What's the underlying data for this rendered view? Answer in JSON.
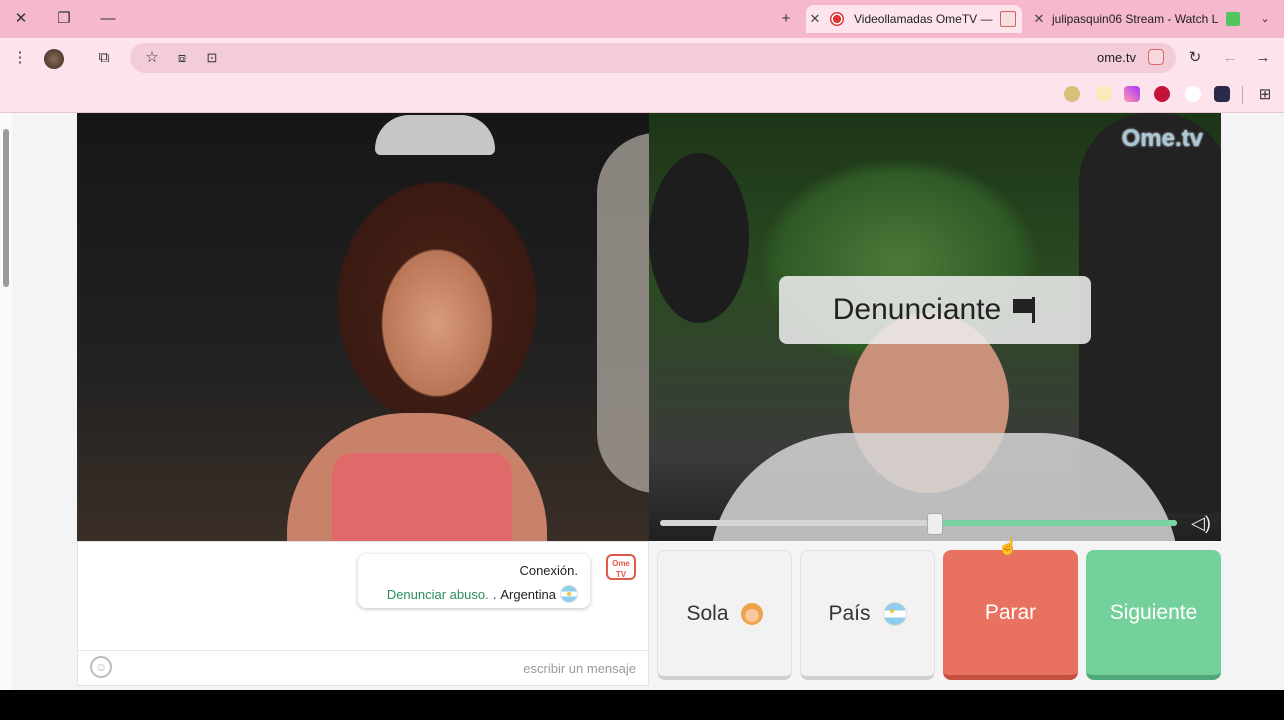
{
  "browser": {
    "tabs": [
      {
        "title": "julipasquin06 Stream - Watch L",
        "active": false,
        "favicon_color": "#54c45e"
      },
      {
        "title": "Videollamadas OmeTV — A",
        "active": true,
        "favicon_color": "#d33"
      }
    ],
    "new_tab_label": "+",
    "url": "ome.tv",
    "window_controls": {
      "close": "✕",
      "restore": "❐",
      "minimize": "—"
    }
  },
  "videos": {
    "watermark": "Ome.tv",
    "overlay_label": "Denunciante",
    "volume_level": 0.47
  },
  "chat": {
    "line1": "Conexión.",
    "country": "Argentina",
    "separator": ".",
    "report_link": "Denunciar abuso.",
    "logo_text": "Ome TV",
    "input_placeholder": "escribir un mensaje"
  },
  "buttons": {
    "next": "Siguiente",
    "stop": "Parar",
    "country": "País",
    "gender": "Sola"
  },
  "colors": {
    "tabbar": "#f5b8cd",
    "toolbar": "#fde4ec",
    "green": "#74d19c",
    "red": "#e8725f"
  }
}
